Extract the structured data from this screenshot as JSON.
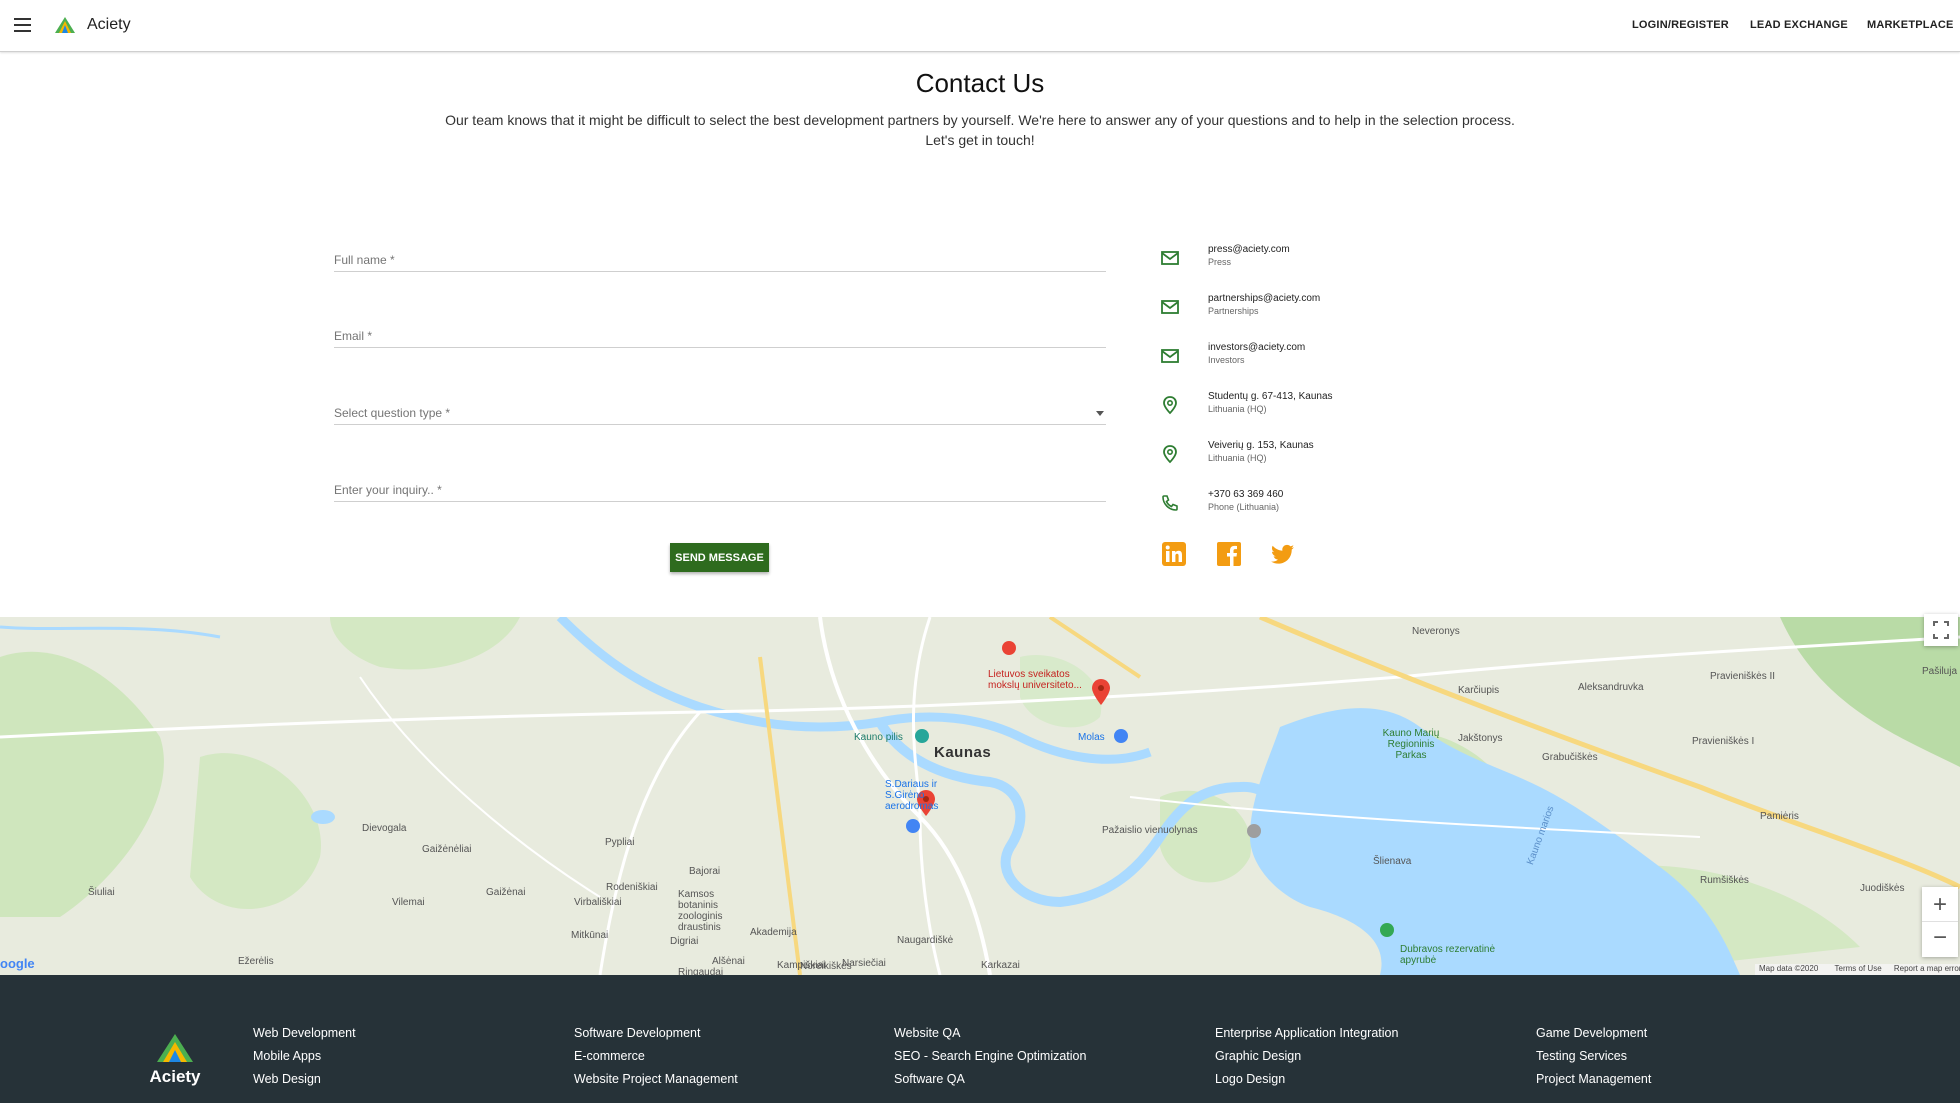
{
  "header": {
    "brand": "Aciety",
    "nav": [
      "LOGIN/REGISTER",
      "LEAD EXCHANGE",
      "MARKETPLACE"
    ]
  },
  "page": {
    "title": "Contact Us",
    "intro_line1": "Our team knows that it might be difficult to select the best development partners by yourself. We're here to answer any of your questions and to help in the selection process.",
    "intro_line2": "Let's get in touch!"
  },
  "form": {
    "full_name_placeholder": "Full name *",
    "email_placeholder": "Email *",
    "question_type_placeholder": "Select question type *",
    "inquiry_placeholder": "Enter your inquiry.. *",
    "send_label": "SEND MESSAGE"
  },
  "contacts": [
    {
      "icon": "mail-icon",
      "main": "press@aciety.com",
      "sub": "Press"
    },
    {
      "icon": "mail-icon",
      "main": "partnerships@aciety.com",
      "sub": "Partnerships"
    },
    {
      "icon": "mail-icon",
      "main": "investors@aciety.com",
      "sub": "Investors"
    },
    {
      "icon": "location-pin-icon",
      "main": "Studentų g. 67-413, Kaunas",
      "sub": "Lithuania (HQ)"
    },
    {
      "icon": "location-pin-icon",
      "main": "Veiverių g. 153, Kaunas",
      "sub": "Lithuania (HQ)"
    },
    {
      "icon": "phone-icon",
      "main": "+370 63 369 460",
      "sub": "Phone (Lithuania)"
    }
  ],
  "social": [
    "linkedin-icon",
    "facebook-icon",
    "twitter-icon"
  ],
  "map": {
    "city": "Kaunas",
    "labels": [
      "Dievogala",
      "Gaižėnėliai",
      "Pypliai",
      "Šiuliai",
      "Vilemai",
      "Gaižėnai",
      "Virbališkiai",
      "Kamsos botaninis zoologinis draustinis",
      "Akademija",
      "Mitkūnai",
      "Ežerėlis",
      "Noreikiškės",
      "Ringaudai",
      "Bajorai",
      "Rodeniškiai",
      "Digriai",
      "Alšėnai",
      "Kampiškiai",
      "Narsiečiai",
      "Naugardiškė",
      "Karkazai",
      "Kauno pilis",
      "S.Dariaus ir S.Girėno aerodromas",
      "Lietuvos sveikatos mokslų universiteto...",
      "Molas",
      "Pažaislio vienuolynas",
      "Kauno Marių Regioninis Parkas",
      "Karčiupis",
      "Aleksandruvka",
      "Jakštonys",
      "Grabučiškės",
      "Neveronys",
      "Pravieniškės II",
      "Pravieniškės I",
      "Pamiėris",
      "Rumšiškės",
      "Juodiškės",
      "Šlienava",
      "Dubravos rezervatinė apyrubė",
      "Pašiluja",
      "Kauno marios"
    ],
    "attribution": [
      "Map data ©2020",
      "Terms of Use",
      "Report a map error"
    ],
    "google": "oogle",
    "zoom_in": "+",
    "zoom_out": "−"
  },
  "footer": {
    "logo_text": "Aciety",
    "columns": [
      [
        "Web Development",
        "Mobile Apps",
        "Web Design"
      ],
      [
        "Software Development",
        "E-commerce",
        "Website Project Management"
      ],
      [
        "Website QA",
        "SEO - Search Engine Optimization",
        "Software QA"
      ],
      [
        "Enterprise Application Integration",
        "Graphic Design",
        "Logo Design"
      ],
      [
        "Game Development",
        "Testing Services",
        "Project Management"
      ]
    ]
  },
  "colors": {
    "accent_green": "#2e6b1e",
    "icon_green": "#2e7d32",
    "social_orange": "#f39c12",
    "footer_bg": "#263238",
    "water": "#aadaff",
    "park": "#c8e3b4"
  }
}
